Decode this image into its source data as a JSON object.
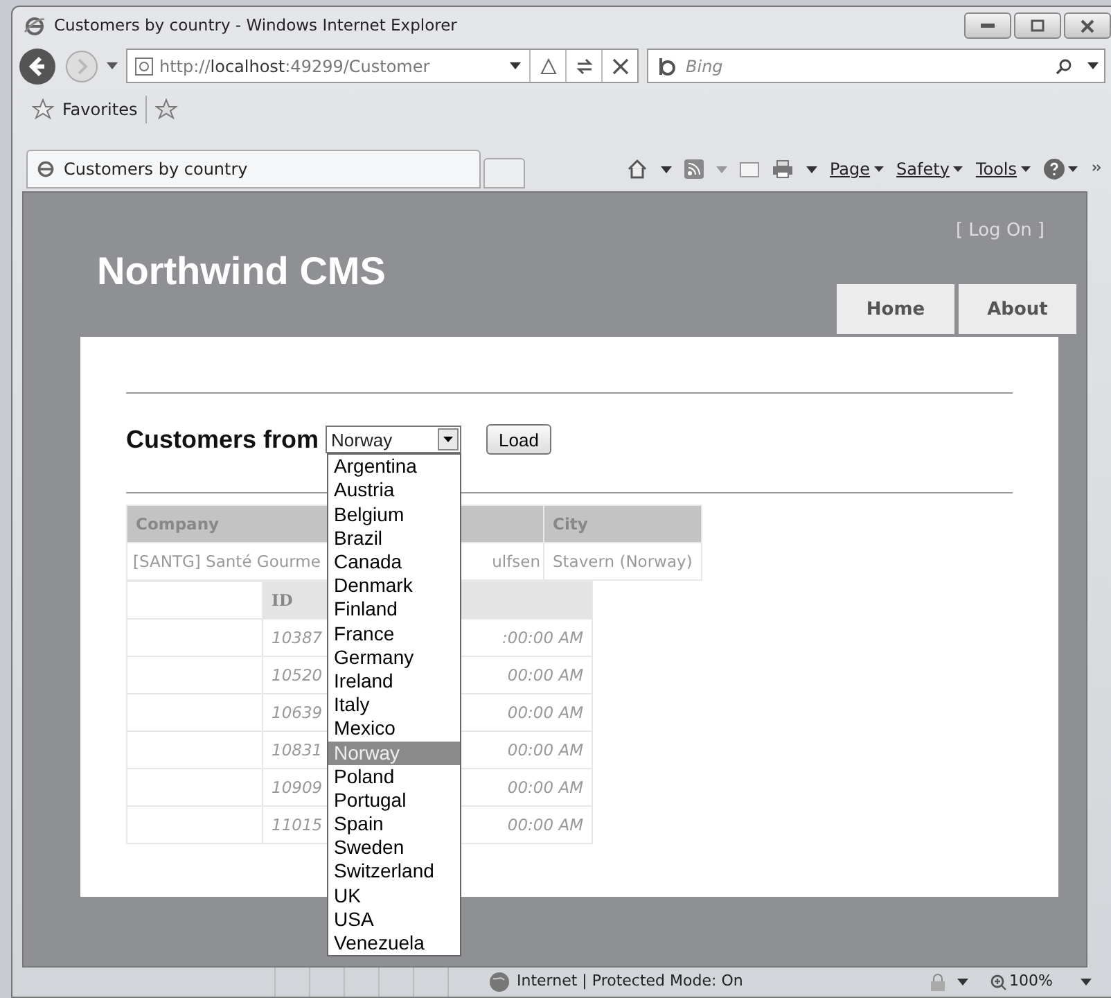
{
  "window": {
    "title": "Customers by country - Windows Internet Explorer"
  },
  "address_bar": {
    "url": "http://**localhost**:49299/Customer"
  },
  "search": {
    "placeholder": "Bing"
  },
  "favorites_bar": {
    "label": "Favorites"
  },
  "tabs": [
    {
      "label": "Customers by country",
      "selected": true
    }
  ],
  "command_bar": [
    "Page",
    "Safety",
    "Tools"
  ],
  "page": {
    "login": {
      "open": "[",
      "link": "Log On",
      "close": "]"
    },
    "site_title": "Northwind CMS",
    "menu": [
      {
        "label": "Home"
      },
      {
        "label": "About"
      }
    ],
    "filter": {
      "label": "Customers from",
      "value": "Norway",
      "button": "Load",
      "options": [
        {
          "label": "Argentina",
          "selected": false
        },
        {
          "label": "Austria",
          "selected": false
        },
        {
          "label": "Belgium",
          "selected": false
        },
        {
          "label": "Brazil",
          "selected": false
        },
        {
          "label": "Canada",
          "selected": false
        },
        {
          "label": "Denmark",
          "selected": false
        },
        {
          "label": "Finland",
          "selected": false
        },
        {
          "label": "France",
          "selected": false
        },
        {
          "label": "Germany",
          "selected": false
        },
        {
          "label": "Ireland",
          "selected": false
        },
        {
          "label": "Italy",
          "selected": false
        },
        {
          "label": "Mexico",
          "selected": false
        },
        {
          "label": "Norway",
          "selected": true
        },
        {
          "label": "Poland",
          "selected": false
        },
        {
          "label": "Portugal",
          "selected": false
        },
        {
          "label": "Spain",
          "selected": false
        },
        {
          "label": "Sweden",
          "selected": false
        },
        {
          "label": "Switzerland",
          "selected": false
        },
        {
          "label": "UK",
          "selected": false
        },
        {
          "label": "USA",
          "selected": false
        },
        {
          "label": "Venezuela",
          "selected": false
        }
      ]
    },
    "customers_table": {
      "columns": {
        "company": "Company",
        "city": "City"
      },
      "rows": [
        {
          "company": "[SANTG] Santé Gourme",
          "column_2": "ulfsen",
          "city": "Stavern (Norway)"
        }
      ]
    },
    "orders_table": {
      "columns": {
        "id": "ID"
      },
      "rows": [
        {
          "id": "10387",
          "column_3": ":00:00 AM"
        },
        {
          "id": "10520",
          "column_3": "00:00 AM"
        },
        {
          "id": "10639",
          "column_3": "00:00 AM"
        },
        {
          "id": "10831",
          "column_3": "00:00 AM"
        },
        {
          "id": "10909",
          "column_3": "00:00 AM"
        },
        {
          "id": "11015",
          "column_3": "00:00 AM"
        }
      ]
    }
  },
  "status_bar": {
    "zone": "Internet | Protected Mode: On",
    "zoom": "100%"
  }
}
